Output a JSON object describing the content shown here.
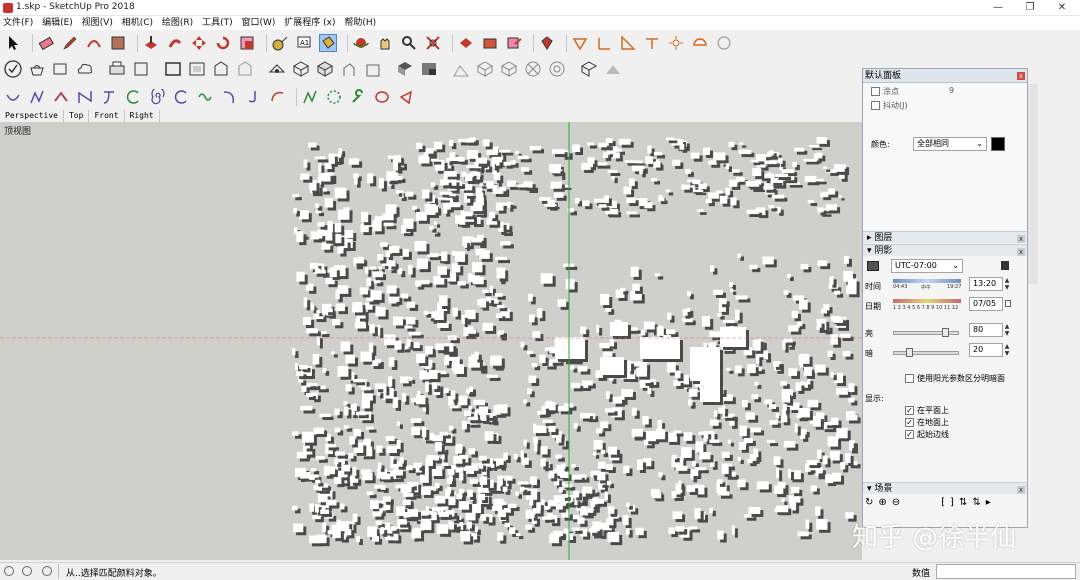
{
  "window": {
    "title": "1.skp - SketchUp Pro 2018",
    "controls": [
      "—",
      "❐",
      "✕"
    ]
  },
  "menubar": {
    "items": [
      "文件(F)",
      "编辑(E)",
      "视图(V)",
      "相机(C)",
      "绘图(R)",
      "工具(T)",
      "窗口(W)",
      "扩展程序 (x)",
      "帮助(H)"
    ]
  },
  "scenes": {
    "tabs": [
      "Perspective",
      "Top",
      "Front",
      "Right"
    ]
  },
  "viewport": {
    "label": "顶视图",
    "background": "#cfcfcc",
    "axis_green": "#2fa52f",
    "axis_red": "#d07070"
  },
  "tray": {
    "title": "默认面板",
    "rows_top": [
      {
        "label": "涂点",
        "value": "9"
      },
      {
        "label": "抖动(J)",
        "value": ""
      }
    ],
    "color_label": "颜色:",
    "color_value": "全部相同",
    "sections": {
      "layers": "图层",
      "shadows": "阴影",
      "scenes": "场景"
    },
    "shadows": {
      "timezone": "UTC-07:00",
      "time_label": "时间",
      "time_start": "04:43",
      "time_mid": "中午",
      "time_end": "19:27",
      "time_value": "13:20",
      "date_label": "日期",
      "months": "1 2 3 4 5 6 7 8 9 10 11 12",
      "date_value": "07/05",
      "light_label": "亮",
      "light_value": "80",
      "light_fraction": 0.8,
      "dark_label": "暗",
      "dark_value": "20",
      "dark_fraction": 0.2,
      "sun_option": "使用阳光参数区分明暗面",
      "display_label": "显示:",
      "display_options": [
        "在平面上",
        "在地面上",
        "起始边线"
      ]
    },
    "scenes_icons": [
      "↻",
      "⊕",
      "⊖",
      "⁅",
      "⁆",
      "⇅",
      "⇅",
      "▸"
    ]
  },
  "status": {
    "message": "从..选择匹配颜料对象。",
    "measure_label": "数值"
  },
  "watermark": "知乎 @徐半仙"
}
